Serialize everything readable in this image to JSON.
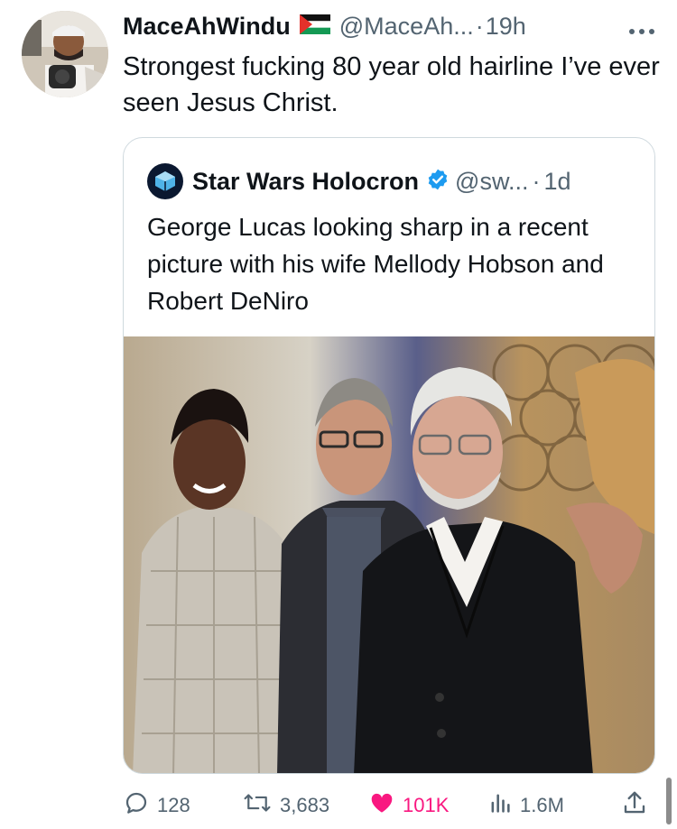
{
  "tweet": {
    "display_name": "MaceAhWindu",
    "handle": "@MaceAh...",
    "time": "19h",
    "separator": "·",
    "text": "Strongest fucking 80 year old hairline I’ve ever seen Jesus Christ."
  },
  "quote": {
    "display_name": "Star Wars Holocron",
    "handle": "@sw...",
    "time": "1d",
    "separator": "·",
    "text": "George Lucas looking sharp in a recent picture with his wife Mellody Hobson and Robert DeNiro"
  },
  "actions": {
    "replies": "128",
    "retweets": "3,683",
    "likes": "101K",
    "views": "1.6M"
  },
  "colors": {
    "like": "#f91880",
    "verified": "#1d9bf0",
    "muted": "#536471"
  },
  "icons": [
    "more-icon",
    "flag-icon",
    "holocron-icon",
    "verified-icon",
    "reply-icon",
    "retweet-icon",
    "like-icon",
    "views-icon",
    "share-icon"
  ]
}
